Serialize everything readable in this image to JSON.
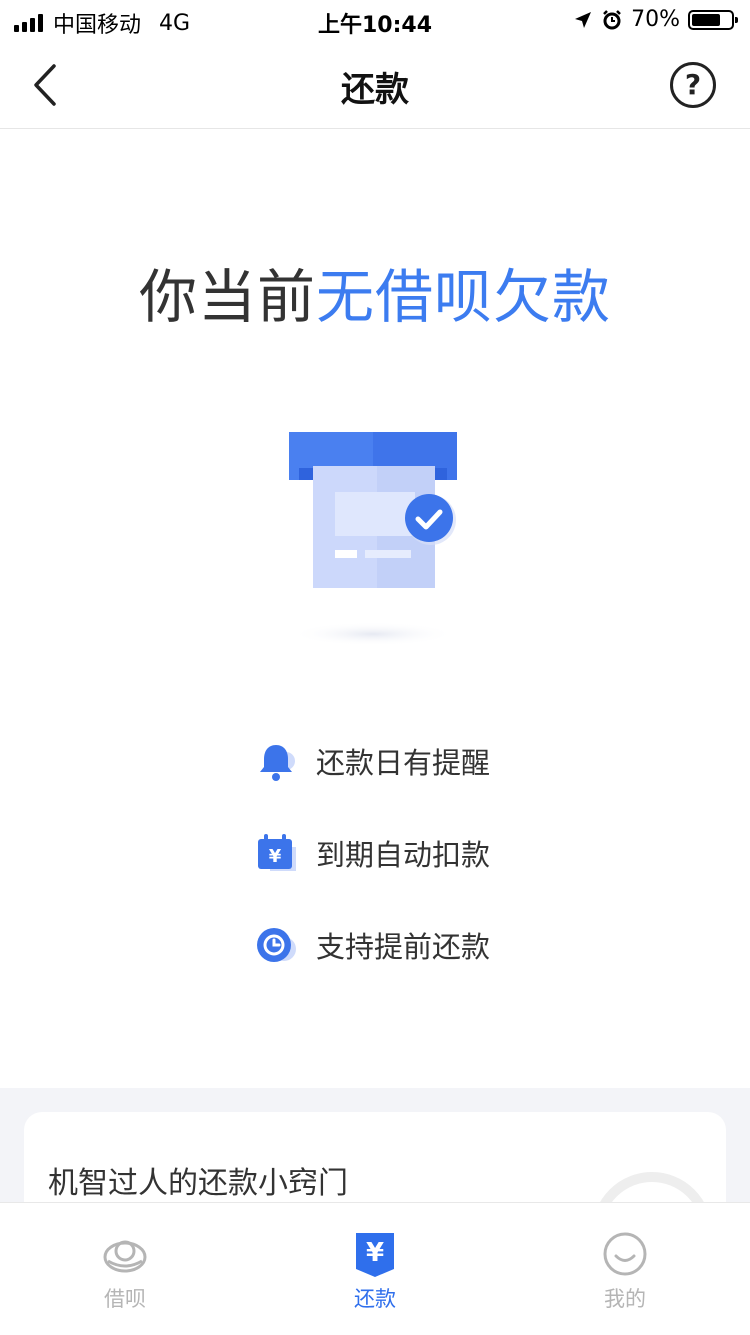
{
  "status_bar": {
    "carrier": "中国移动",
    "network": "4G",
    "time": "上午10:44",
    "battery": "70%"
  },
  "nav": {
    "title": "还款",
    "help_label": "?"
  },
  "headline": {
    "prefix": "你当前",
    "highlight": "无借呗欠款"
  },
  "features": [
    {
      "icon": "bell-icon",
      "label": "还款日有提醒"
    },
    {
      "icon": "calendar-yuan-icon",
      "label": "到期自动扣款"
    },
    {
      "icon": "clock-icon",
      "label": "支持提前还款"
    }
  ],
  "card": {
    "title": "机智过人的还款小窍门"
  },
  "tab_bar": {
    "tabs": [
      {
        "icon": "jiebei-icon",
        "label": "借呗",
        "active": false
      },
      {
        "icon": "repay-yuan-icon",
        "label": "还款",
        "active": true
      },
      {
        "icon": "smiley-icon",
        "label": "我的",
        "active": false
      }
    ]
  },
  "colors": {
    "accent": "#3c7cf0",
    "tab_active": "#2f6fec",
    "tab_inactive": "#b5b5b5"
  }
}
